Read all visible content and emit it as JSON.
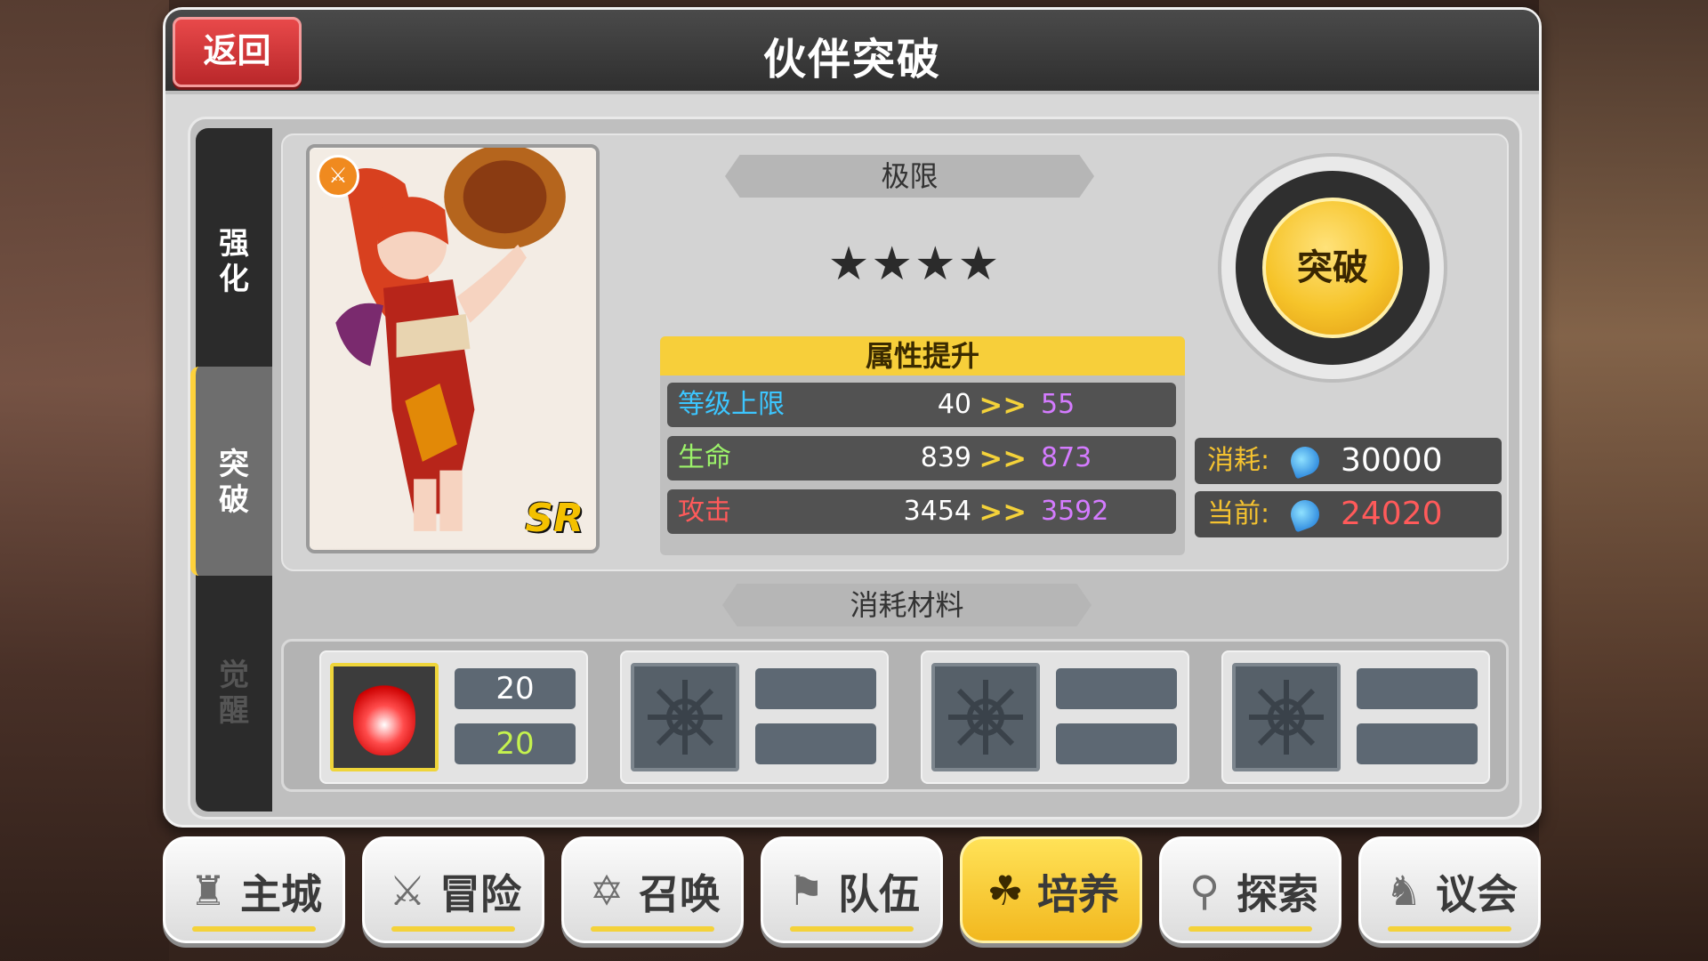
{
  "header": {
    "back_label": "返回",
    "title": "伙伴突破"
  },
  "side_tabs": [
    {
      "label": "强\n化"
    },
    {
      "label": "突\n破"
    },
    {
      "label": "觉\n醒"
    }
  ],
  "card": {
    "rarity": "SR",
    "badge_icon": "sword-icon"
  },
  "limit": {
    "label": "极限",
    "stars": "★★★★"
  },
  "attributes": {
    "header": "属性提升",
    "rows": [
      {
        "label": "等级上限",
        "current": "40",
        "next": "55"
      },
      {
        "label": "生命",
        "current": "839",
        "next": "873"
      },
      {
        "label": "攻击",
        "current": "3454",
        "next": "3592"
      }
    ]
  },
  "breakthrough": {
    "button_label": "突破"
  },
  "cost": {
    "consume_label": "消耗:",
    "consume_value": "30000",
    "current_label": "当前:",
    "current_value": "24020"
  },
  "materials": {
    "label": "消耗材料",
    "slots": [
      {
        "need": "20",
        "have": "20",
        "icon": "flame-emblem-icon"
      },
      {
        "need": "",
        "have": "",
        "icon": "empty-slot-icon"
      },
      {
        "need": "",
        "have": "",
        "icon": "empty-slot-icon"
      },
      {
        "need": "",
        "have": "",
        "icon": "empty-slot-icon"
      }
    ]
  },
  "nav": [
    {
      "label": "主城",
      "icon": "castle-icon"
    },
    {
      "label": "冒险",
      "icon": "crossed-swords-icon"
    },
    {
      "label": "召唤",
      "icon": "summon-circle-icon"
    },
    {
      "label": "队伍",
      "icon": "team-icon"
    },
    {
      "label": "培养",
      "icon": "train-icon",
      "active": true
    },
    {
      "label": "探索",
      "icon": "explore-icon"
    },
    {
      "label": "议会",
      "icon": "council-icon"
    }
  ]
}
